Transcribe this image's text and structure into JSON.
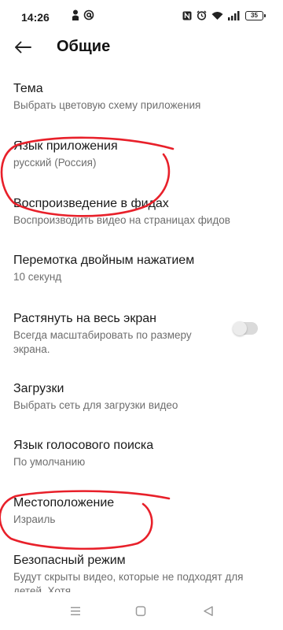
{
  "status_bar": {
    "time": "14:26",
    "battery": "35"
  },
  "header": {
    "title": "Общие"
  },
  "settings": [
    {
      "title": "Тема",
      "subtitle": "Выбрать цветовую схему приложения"
    },
    {
      "title": "Язык приложения",
      "subtitle": "русский (Россия)"
    },
    {
      "title": "Воспроизведение в фидах",
      "subtitle": "Воспроизводить видео на страницах фидов"
    },
    {
      "title": "Перемотка двойным нажатием",
      "subtitle": "10 секунд"
    },
    {
      "title": "Растянуть на весь экран",
      "subtitle": "Всегда масштабировать по размеру экрана.",
      "toggle": false
    },
    {
      "title": "Загрузки",
      "subtitle": "Выбрать сеть для загрузки видео"
    },
    {
      "title": "Язык голосового поиска",
      "subtitle": "По умолчанию"
    },
    {
      "title": "Местоположение",
      "subtitle": "Израиль"
    },
    {
      "title": "Безопасный режим",
      "subtitle": "Будут скрыты видео, которые не подходят для детей. Хотя"
    }
  ],
  "colors": {
    "annotation_red": "#e8202a",
    "toggle_off": "#dadada",
    "subtitle_gray": "#6e6e6e"
  },
  "icons": {
    "status_left": [
      "person-icon",
      "at-sign-icon"
    ],
    "status_right": [
      "nfc-icon",
      "alarm-icon",
      "wifi-icon",
      "signal-icon",
      "battery-icon"
    ],
    "nav": [
      "menu-icon",
      "home-square-icon",
      "back-triangle-icon"
    ]
  }
}
